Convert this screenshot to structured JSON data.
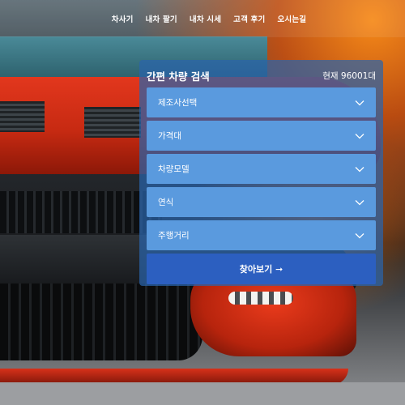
{
  "nav": {
    "items": [
      "차사기",
      "내차 팔기",
      "내차 시세",
      "고객 후기",
      "오시는길"
    ]
  },
  "search": {
    "title": "간편 차량 검색",
    "count": "현재 96001대",
    "selects": [
      {
        "label": "제조사선택"
      },
      {
        "label": "가격대"
      },
      {
        "label": "차량모델"
      },
      {
        "label": "연식"
      },
      {
        "label": "주행거리"
      }
    ],
    "button_label": "찾아보기 ➞"
  },
  "colors": {
    "panel": "#2a64aa",
    "select": "#5a9ade",
    "button": "#2c5fc0"
  },
  "icons": {
    "select_arrow": "chevron-down-icon"
  }
}
